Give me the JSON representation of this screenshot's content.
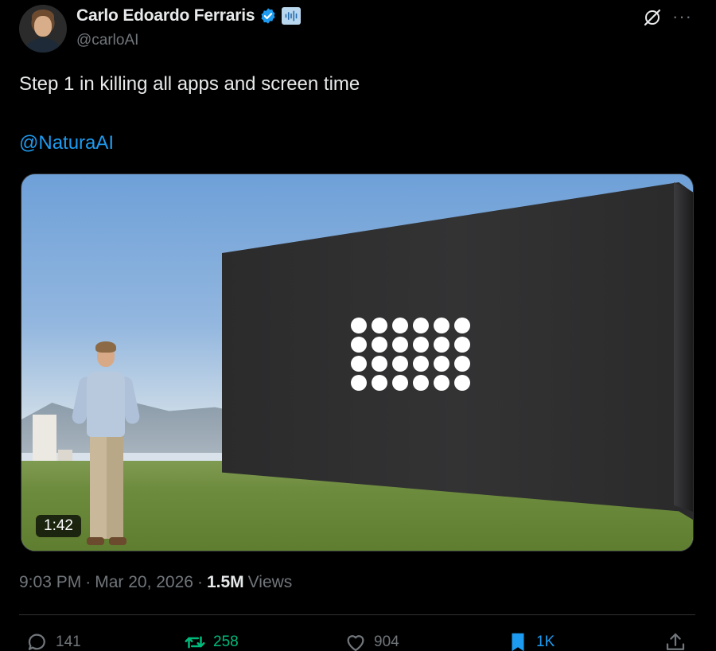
{
  "author": {
    "display_name": "Carlo Edoardo Ferraris",
    "handle": "@carloAI",
    "verified_color": "#1d9bf0"
  },
  "header": {
    "grok_icon": "grok-icon",
    "more_label": "···"
  },
  "tweet": {
    "text": "Step 1 in killing all apps and screen time",
    "mention": "@NaturaAI"
  },
  "media": {
    "type": "video",
    "duration": "1:42"
  },
  "meta": {
    "time": "9:03 PM",
    "separator": "·",
    "date": "Mar 20, 2026",
    "separator2": "·",
    "views_count": "1.5M",
    "views_label": "Views"
  },
  "actions": {
    "replies": "141",
    "reposts": "258",
    "likes": "904",
    "bookmarks": "1K"
  },
  "colors": {
    "background": "#000000",
    "text": "#e7e9ea",
    "muted": "#71767b",
    "link": "#1d9bf0",
    "repost_active": "#00ba7c"
  }
}
